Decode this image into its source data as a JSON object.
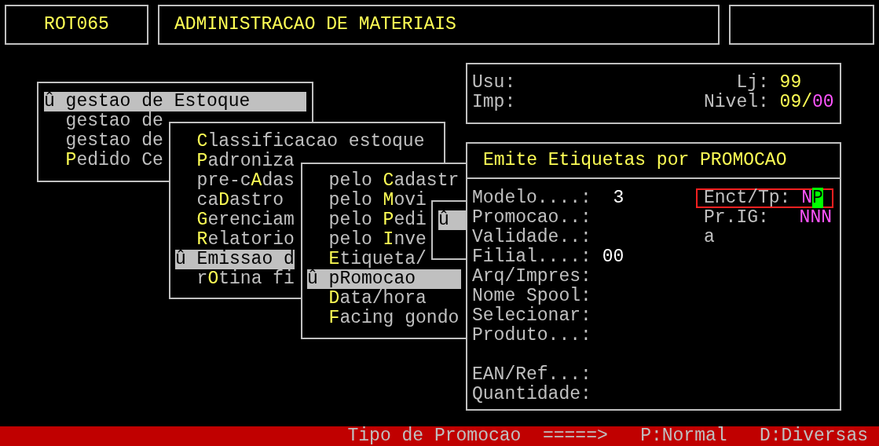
{
  "header": {
    "program_code": "ROT065",
    "system_title": "ADMINISTRACAO DE MATERIAIS"
  },
  "menus": [
    {
      "items": [
        {
          "label": "û gestao de Estoque",
          "selected": true
        },
        {
          "label": "gestao de",
          "selected": false
        },
        {
          "label": "gestao de",
          "selected": false
        },
        {
          "label": "**P**edido Ce",
          "selected": false
        }
      ]
    },
    {
      "items": [
        {
          "label": "**C**lassificacao estoque",
          "selected": false
        },
        {
          "label": "**P**adroniza",
          "selected": false
        },
        {
          "label": "pre-c**A**das",
          "selected": false
        },
        {
          "label": "ca**D**astro",
          "selected": false
        },
        {
          "label": "**G**erenciam",
          "selected": false
        },
        {
          "label": "**R**elatorio",
          "selected": false
        },
        {
          "label": "û Emissao d",
          "selected": true
        },
        {
          "label": "r**O**tina fi",
          "selected": false
        }
      ]
    },
    {
      "items": [
        {
          "label": "pelo **C**adastr",
          "selected": false
        },
        {
          "label": "pelo **M**ovi",
          "selected": false
        },
        {
          "label": "pelo **P**edi",
          "selected": false
        },
        {
          "label": "pelo **I**nve",
          "selected": false
        },
        {
          "label": "**E**tiqueta/",
          "selected": false
        },
        {
          "label": "û p**R**omocao",
          "selected": true
        },
        {
          "label": "**D**ata/hora",
          "selected": false
        },
        {
          "label": "**F**acing gondo",
          "selected": false
        }
      ]
    },
    {
      "items": [
        {
          "label": "û",
          "selected": true
        }
      ]
    }
  ],
  "info": {
    "user_label": "Usu:",
    "printer_label": "Imp:",
    "store_label": "Lj:",
    "store_value": "99",
    "level_label": "Nivel:",
    "level_value": "09/*00*"
  },
  "form": {
    "title": "Emite Etiquetas por PROMOCAO",
    "fields": [
      {
        "label": "Modelo....:",
        "value": " 3"
      },
      {
        "label": "Promocao..:"
      },
      {
        "label": "Validade..:"
      },
      {
        "label": "Filial....:",
        "value": "00"
      },
      {
        "label": "Arq/Impres:"
      },
      {
        "label": "Nome Spool:"
      },
      {
        "label": "Selecionar:"
      },
      {
        "label": "Produto...:"
      }
    ],
    "lookup_fields": [
      {
        "label": "EAN/Ref...:"
      },
      {
        "label": "Quantidade:"
      }
    ],
    "options": [
      {
        "label": "Enct/Tp:",
        "value": "N**P**",
        "highlighted": true
      },
      {
        "label": "Pr.IG:",
        "value": "NNN",
        "highlighted": false
      },
      {
        "label": "a",
        "highlighted": false
      }
    ]
  },
  "status_bar": {
    "prompt": "Tipo de Promocao",
    "arrow": "=====>",
    "choices": [
      "P:Normal",
      "D:Diversas"
    ]
  }
}
